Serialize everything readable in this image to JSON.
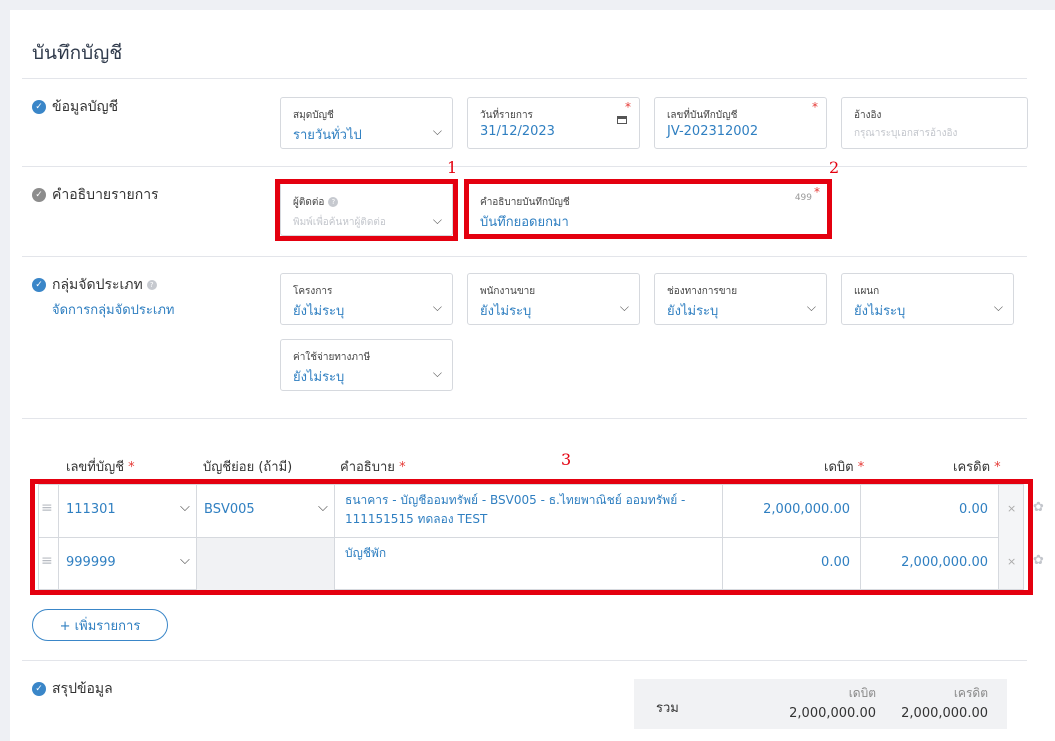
{
  "page": {
    "title": "บันทึกบัญชี"
  },
  "sections": {
    "account_info": {
      "label": "ข้อมูลบัญชี",
      "journal": {
        "label": "สมุดบัญชี",
        "value": "รายวันทั่วไป"
      },
      "date": {
        "label": "วันที่รายการ",
        "value": "31/12/2023"
      },
      "doc_no": {
        "label": "เลขที่บันทึกบัญชี",
        "value": "JV-202312002"
      },
      "reference": {
        "label": "อ้างอิง",
        "placeholder": "กรุณาระบุเอกสารอ้างอิง"
      }
    },
    "description": {
      "label": "คำอธิบายรายการ",
      "contact": {
        "label": "ผู้ติดต่อ",
        "placeholder": "พิมพ์เพื่อค้นหาผู้ติดต่อ"
      },
      "memo": {
        "label": "คำอธิบายบันทึกบัญชี",
        "counter": "499",
        "value": "บันทึกยอดยกมา"
      }
    },
    "grouping": {
      "label": "กลุ่มจัดประเภท",
      "manage_link": "จัดการกลุ่มจัดประเภท",
      "project": {
        "label": "โครงการ",
        "value": "ยังไม่ระบุ"
      },
      "salesperson": {
        "label": "พนักงานขาย",
        "value": "ยังไม่ระบุ"
      },
      "channel": {
        "label": "ช่องทางการขาย",
        "value": "ยังไม่ระบุ"
      },
      "department": {
        "label": "แผนก",
        "value": "ยังไม่ระบุ"
      },
      "tax_expense": {
        "label": "ค่าใช้จ่ายทางภาษี",
        "value": "ยังไม่ระบุ"
      }
    },
    "summary": {
      "label": "สรุปข้อมูล",
      "total_label": "รวม",
      "debit_label": "เดบิต",
      "credit_label": "เครดิต",
      "debit_total": "2,000,000.00",
      "credit_total": "2,000,000.00"
    }
  },
  "table": {
    "headers": {
      "account": "เลขที่บัญชี",
      "sub": "บัญชีย่อย (ถ้ามี)",
      "desc": "คำอธิบาย",
      "debit": "เดบิต",
      "credit": "เครดิต"
    },
    "rows": [
      {
        "account": "111301",
        "sub": "BSV005",
        "desc1": "ธนาคาร - บัญชีออมทรัพย์ - BSV005 - ธ.ไทยพาณิชย์ ออมทรัพย์ -",
        "desc2": "111151515 ทดลอง TEST",
        "debit": "2,000,000.00",
        "credit": "0.00"
      },
      {
        "account": "999999",
        "sub": "",
        "desc1": "บัญชีพัก",
        "desc2": "",
        "debit": "0.00",
        "credit": "2,000,000.00"
      }
    ],
    "add_button": "+ เพิ่มรายการ"
  },
  "annotations": {
    "a1": "1",
    "a2": "2",
    "a3": "3"
  },
  "colors": {
    "accent": "#2f7fc1",
    "highlight": "#e4000f",
    "required": "#e53935"
  }
}
